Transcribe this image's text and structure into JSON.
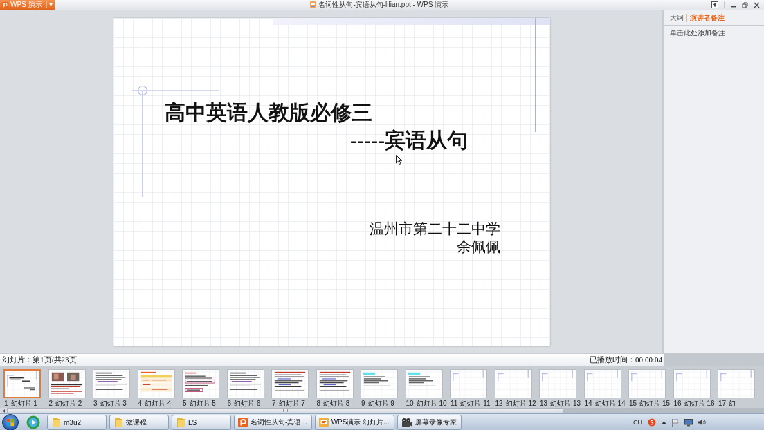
{
  "title_bar": {
    "app_menu": "WPS 演示",
    "title": "名词性从句-宾语从句-lilian.ppt - WPS 演示"
  },
  "slide": {
    "title": "高中英语人教版必修三",
    "subtitle": "-----宾语从句",
    "school": "温州市第二十二中学",
    "author": "余佩佩"
  },
  "notes_panel": {
    "tabs": [
      {
        "label": "大纲",
        "selected": false
      },
      {
        "label": "演讲者备注",
        "selected": true
      }
    ],
    "placeholder": "单击此处添加备注"
  },
  "status_bar": {
    "slide_position": "幻灯片：第1页/共23页",
    "elapsed_time": "已播放时间：00:00:04"
  },
  "thumbnails": [
    {
      "number": "1",
      "label": "幻灯片 1",
      "selected": true,
      "kind": "title"
    },
    {
      "number": "2",
      "label": "幻灯片 2",
      "selected": false,
      "kind": "photos"
    },
    {
      "number": "3",
      "label": "幻灯片 3",
      "selected": false,
      "kind": "text"
    },
    {
      "number": "4",
      "label": "幻灯片 4",
      "selected": false,
      "kind": "table"
    },
    {
      "number": "5",
      "label": "幻灯片 5",
      "selected": false,
      "kind": "boxed"
    },
    {
      "number": "6",
      "label": "幻灯片 6",
      "selected": false,
      "kind": "text"
    },
    {
      "number": "7",
      "label": "幻灯片 7",
      "selected": false,
      "kind": "list"
    },
    {
      "number": "8",
      "label": "幻灯片 8",
      "selected": false,
      "kind": "list"
    },
    {
      "number": "9",
      "label": "幻灯片 9",
      "selected": false,
      "kind": "highlight"
    },
    {
      "number": "10",
      "label": "幻灯片 10",
      "selected": false,
      "kind": "highlight"
    },
    {
      "number": "11",
      "label": "幻灯片 11",
      "selected": false,
      "kind": "blank"
    },
    {
      "number": "12",
      "label": "幻灯片 12",
      "selected": false,
      "kind": "blank"
    },
    {
      "number": "13",
      "label": "幻灯片 13",
      "selected": false,
      "kind": "blank"
    },
    {
      "number": "14",
      "label": "幻灯片 14",
      "selected": false,
      "kind": "blank"
    },
    {
      "number": "15",
      "label": "幻灯片 15",
      "selected": false,
      "kind": "blank"
    },
    {
      "number": "16",
      "label": "幻灯片 16",
      "selected": false,
      "kind": "blank"
    },
    {
      "number": "17",
      "label": "幻",
      "selected": false,
      "kind": "blank"
    }
  ],
  "taskbar": {
    "buttons": [
      {
        "label": "m3u2",
        "kind": "folder"
      },
      {
        "label": "微课程",
        "kind": "folder"
      },
      {
        "label": "LS",
        "kind": "folder"
      },
      {
        "label": "名词性从句-宾语...",
        "kind": "presentation"
      },
      {
        "label": "WPS演示 幻灯片...",
        "kind": "slideshow"
      },
      {
        "label": "屏幕录像专家",
        "kind": "recorder"
      }
    ],
    "language": "CH"
  }
}
